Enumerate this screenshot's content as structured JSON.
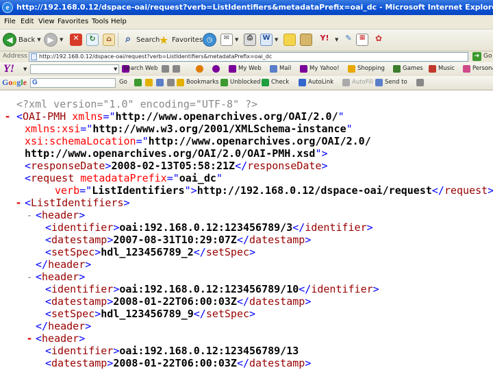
{
  "window": {
    "title": "http://192.168.0.12/dspace-oai/request?verb=ListIdentifiers&metadataPrefix=oai_dc - Microsoft Internet Explorer"
  },
  "menu": [
    "File",
    "Edit",
    "View",
    "Favorites",
    "Tools",
    "Help"
  ],
  "toolbar": {
    "back_label": "Back",
    "search_label": "Search",
    "favorites_label": "Favorites"
  },
  "address": {
    "label": "Address",
    "url": "http://192.168.0.12/dspace-oai/request?verb=ListIdentifiers&metadataPrefix=oai_dc",
    "go_label": "Go"
  },
  "yahoo_toolbar": {
    "search_button": "Search Web",
    "items": [
      "My Web",
      "Mail",
      "My Yahoo!",
      "Shopping",
      "Games",
      "Music",
      "Personals"
    ]
  },
  "google_toolbar": {
    "go_label": "Go",
    "items": [
      "Bookmarks",
      "Unblocked",
      "Check",
      "AutoLink",
      "AutoFill",
      "Send to"
    ]
  },
  "xml": {
    "decl": "<?xml version=\"1.0\" encoding=\"UTF-8\" ?>",
    "root_tag": "OAI-PMH",
    "xmlns_name": "xmlns",
    "xmlns_value": "http://www.openarchives.org/OAI/2.0/",
    "xsi_name": "xmlns:xsi",
    "xsi_value": "http://www.w3.org/2001/XMLSchema-instance",
    "schema_loc_name": "xsi:schemaLocation",
    "schema_loc_value_1": "http://www.openarchives.org/OAI/2.0/",
    "schema_loc_value_2": "http://www.openarchives.org/OAI/2.0/OAI-PMH.xsd",
    "response_date_tag": "responseDate",
    "response_date": "2008-02-13T05:58:21Z",
    "request_tag": "request",
    "request_attr_1_name": "metadataPrefix",
    "request_attr_1_value": "oai_dc",
    "request_attr_2_name": "verb",
    "request_attr_2_value": "ListIdentifiers",
    "request_url": "http://192.168.0.12/dspace-oai/request",
    "list_tag": "ListIdentifiers",
    "header_tag": "header",
    "identifier_tag": "identifier",
    "datestamp_tag": "datestamp",
    "setspec_tag": "setSpec",
    "headers": [
      {
        "identifier": "oai:192.168.0.12:123456789/3",
        "datestamp": "2007-08-31T10:29:07Z",
        "setSpec": "hdl_123456789_2"
      },
      {
        "identifier": "oai:192.168.0.12:123456789/10",
        "datestamp": "2008-01-22T06:00:03Z",
        "setSpec": "hdl_123456789_9"
      },
      {
        "identifier": "oai:192.168.0.12:123456789/13",
        "datestamp": "2008-01-22T06:00:03Z"
      }
    ]
  },
  "colors": {
    "title_bar": "#0a52d6",
    "markup": "#0000ff",
    "tag_name": "#990000",
    "attr_value": "#ff0000",
    "toggle": "#e00000"
  }
}
